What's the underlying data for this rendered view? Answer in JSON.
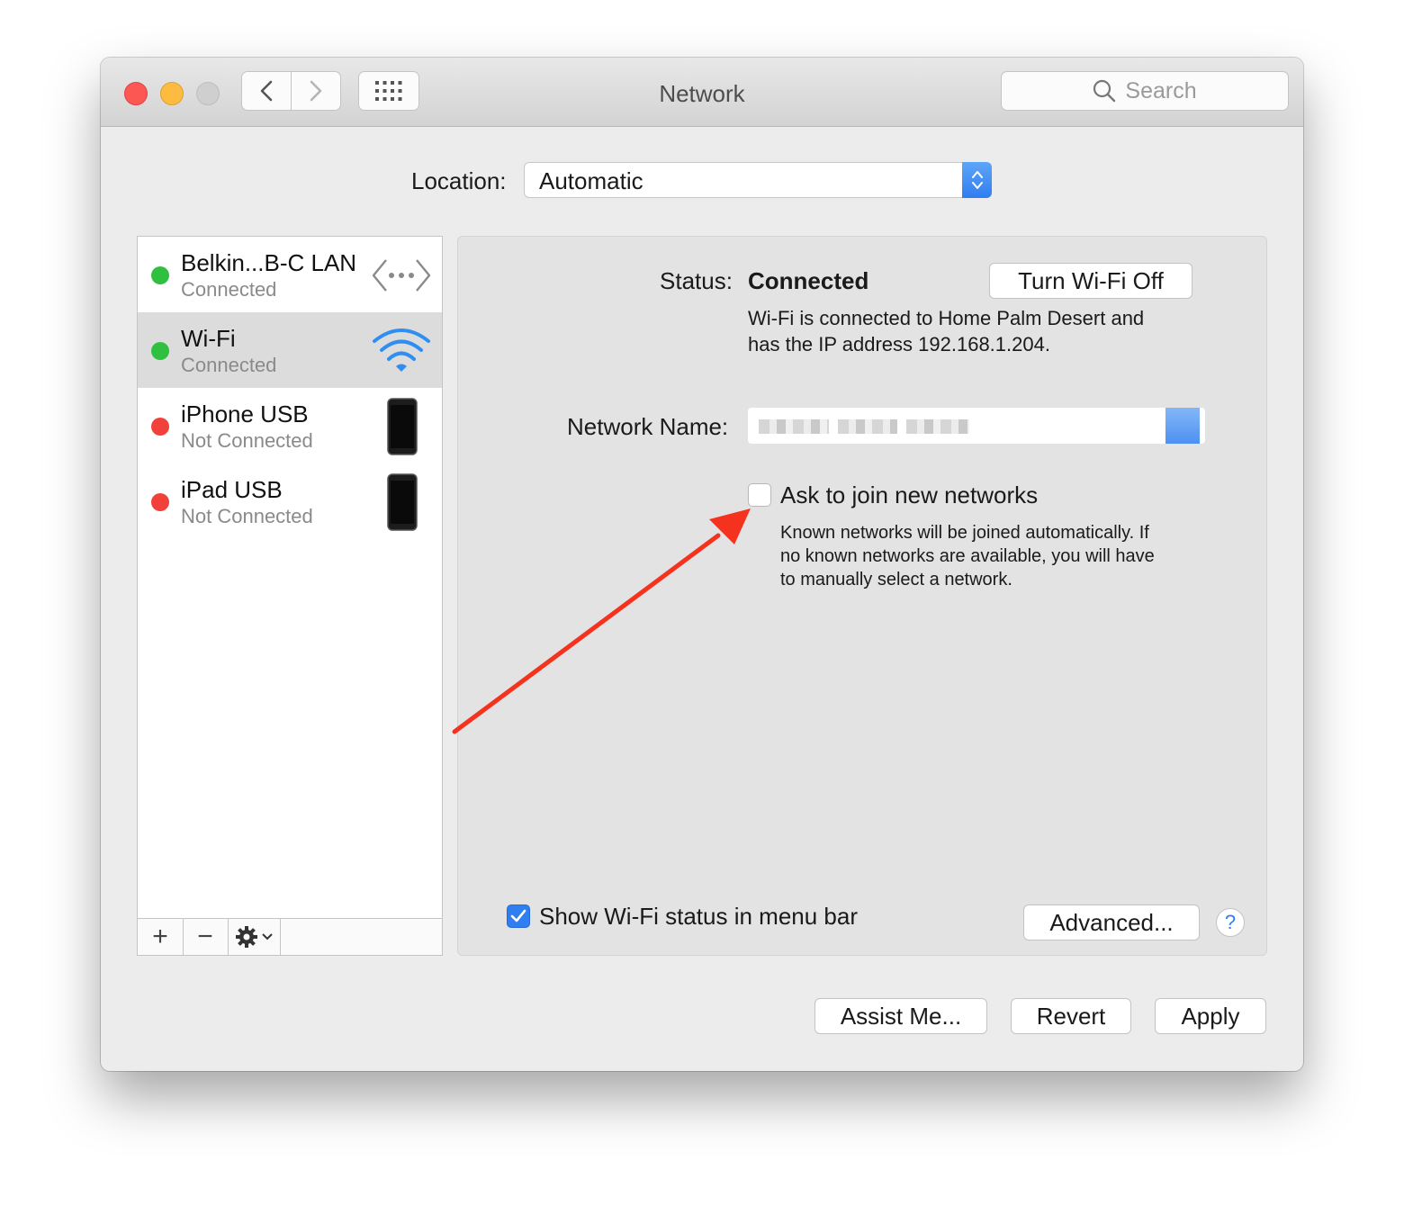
{
  "window": {
    "title": "Network"
  },
  "toolbar": {
    "search_placeholder": "Search"
  },
  "location": {
    "label": "Location:",
    "value": "Automatic"
  },
  "services": [
    {
      "name": "Belkin...B-C LAN",
      "status": "Connected",
      "state": "connected",
      "icon": "ethernet-icon"
    },
    {
      "name": "Wi-Fi",
      "status": "Connected",
      "state": "connected",
      "icon": "wifi-icon"
    },
    {
      "name": "iPhone USB",
      "status": "Not Connected",
      "state": "disconnected",
      "icon": "iphone-icon"
    },
    {
      "name": "iPad USB",
      "status": "Not Connected",
      "state": "disconnected",
      "icon": "ipad-icon"
    }
  ],
  "sidebar_tools": {
    "add": "+",
    "remove": "−"
  },
  "detail": {
    "status_label": "Status:",
    "status_value": "Connected",
    "turn_off_button": "Turn Wi-Fi Off",
    "description_line1": "Wi-Fi is connected to Home Palm Desert and",
    "description_line2": "has the IP address 192.168.1.204.",
    "network_name_label": "Network Name:",
    "ask_join_label": "Ask to join new networks",
    "ask_join_checked": false,
    "ask_join_help_line1": "Known networks will be joined automatically. If",
    "ask_join_help_line2": "no known networks are available, you will have",
    "ask_join_help_line3": "to manually select a network.",
    "show_status_label": "Show Wi-Fi status in menu bar",
    "show_status_checked": true,
    "advanced_button": "Advanced...",
    "help_button": "?"
  },
  "footer": {
    "assist_button": "Assist Me...",
    "revert_button": "Revert",
    "apply_button": "Apply"
  },
  "colors": {
    "accent": "#2f7ff0",
    "connected": "#2fc041",
    "disconnected": "#f2413b",
    "annotation_arrow": "#f5321e"
  }
}
